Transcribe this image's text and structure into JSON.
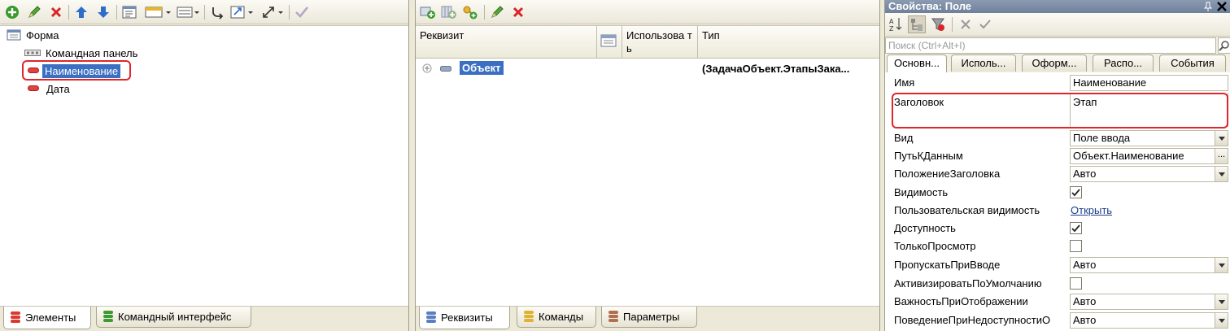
{
  "left_panel": {
    "tree": {
      "root": "Форма",
      "items": [
        "Командная панель",
        "Наименование",
        "Дата"
      ]
    },
    "tabs": [
      "Элементы",
      "Командный интерфейс"
    ]
  },
  "middle_panel": {
    "columns": [
      "Реквизит",
      "Использова ть",
      "Тип"
    ],
    "rows": [
      {
        "name": "Объект",
        "type": "(ЗадачаОбъект.ЭтапыЗака..."
      }
    ],
    "tabs": [
      "Реквизиты",
      "Команды",
      "Параметры"
    ]
  },
  "right_panel": {
    "title": "Свойства: Поле",
    "search_placeholder": "Поиск (Ctrl+Alt+I)",
    "tabs": [
      "Основн...",
      "Исполь...",
      "Оформ...",
      "Распо...",
      "События"
    ],
    "properties": [
      {
        "name": "Имя",
        "value": "Наименование",
        "kind": "text"
      },
      {
        "name": "Заголовок",
        "value": "Этап",
        "kind": "multiline"
      },
      {
        "name": "Вид",
        "value": "Поле ввода",
        "kind": "dropdown"
      },
      {
        "name": "ПутьКДанным",
        "value": "Объект.Наименование",
        "kind": "select"
      },
      {
        "name": "ПоложениеЗаголовка",
        "value": "Авто",
        "kind": "dropdown"
      },
      {
        "name": "Видимость",
        "checked": true,
        "kind": "check"
      },
      {
        "name": "Пользовательская видимость",
        "value": "Открыть",
        "kind": "link"
      },
      {
        "name": "Доступность",
        "checked": true,
        "kind": "check"
      },
      {
        "name": "ТолькоПросмотр",
        "checked": false,
        "kind": "check"
      },
      {
        "name": "ПропускатьПриВводе",
        "value": "Авто",
        "kind": "dropdown"
      },
      {
        "name": "АктивизироватьПоУмолчанию",
        "checked": false,
        "kind": "check"
      },
      {
        "name": "ВажностьПриОтображении",
        "value": "Авто",
        "kind": "dropdown"
      },
      {
        "name": "ПоведениеПриНедоступностиО",
        "value": "Авто",
        "kind": "dropdown"
      }
    ]
  },
  "colors": {
    "highlight": "#e0262b",
    "selection": "#3b6fc2",
    "tool_green": "#3a9a2c",
    "tool_red": "#d9252a",
    "tool_blue": "#2f6dc8"
  }
}
